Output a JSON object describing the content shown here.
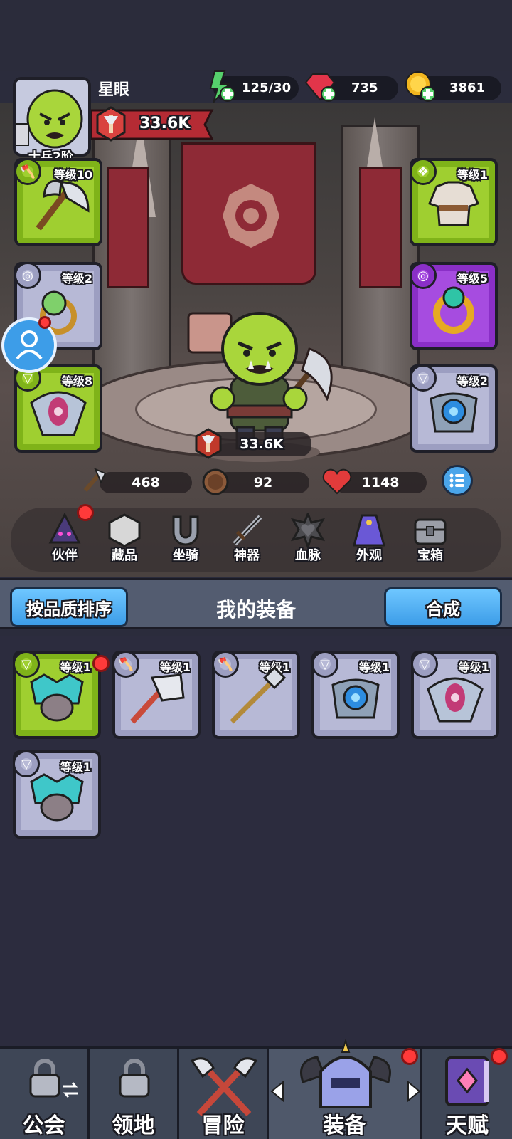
{
  "player": {
    "name": "星眼",
    "rank": "士兵2阶",
    "power": "33.6K"
  },
  "currency": {
    "energy": "125/30",
    "gems": "735",
    "gold": "3861"
  },
  "equipped": {
    "weapon": {
      "level": "等级10"
    },
    "armor": {
      "level": "等级1"
    },
    "ring_left": {
      "level": "等级2"
    },
    "ring_right": {
      "level": "等级5"
    },
    "amulet_left": {
      "level": "等级8"
    },
    "amulet_right": {
      "level": "等级2"
    }
  },
  "stats": {
    "power": "33.6K",
    "attack": "468",
    "defense": "92",
    "hp": "1148"
  },
  "menu": [
    "伙伴",
    "藏品",
    "坐骑",
    "神器",
    "血脉",
    "外观",
    "宝箱"
  ],
  "inventory": {
    "sort_label": "按品质排序",
    "title": "我的装备",
    "merge_label": "合成",
    "items": [
      {
        "level": "等级1"
      },
      {
        "level": "等级1"
      },
      {
        "level": "等级1"
      },
      {
        "level": "等级1"
      },
      {
        "level": "等级1"
      },
      {
        "level": "等级1"
      }
    ]
  },
  "nav": [
    "公会",
    "领地",
    "冒险",
    "装备",
    "天赋"
  ],
  "colors": {
    "green_slot": "#9fcf30",
    "grey_slot": "#b7b9d6",
    "purple_slot": "#a64ce0",
    "button_blue": "#4fb2f5",
    "alert_red": "#ff3a3a"
  }
}
